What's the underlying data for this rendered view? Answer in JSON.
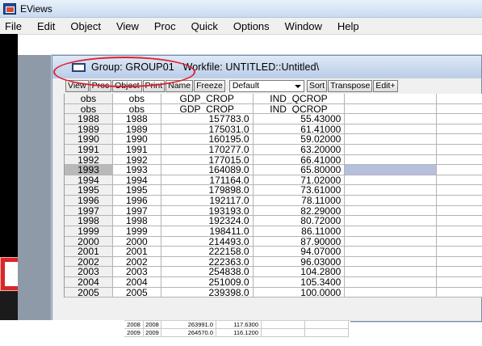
{
  "app": {
    "title": "EViews"
  },
  "menu": [
    "File",
    "Edit",
    "Object",
    "View",
    "Proc",
    "Quick",
    "Options",
    "Window",
    "Help"
  ],
  "group_window": {
    "title": "Group: GROUP01",
    "workfile": "Workfile: UNTITLED::Untitled\\",
    "toolbar": [
      "View",
      "Proc",
      "Object",
      "Print",
      "Name",
      "Freeze"
    ],
    "display_select": "Default",
    "toolbar_right": [
      "Sort",
      "Transpose",
      "Edit+"
    ]
  },
  "table": {
    "header_rows": [
      [
        "obs",
        "obs",
        "GDP_CROP",
        "IND_QCROP"
      ],
      [
        "obs",
        "obs",
        "GDP_CROP",
        "IND_QCROP"
      ]
    ],
    "rows": [
      [
        "1988",
        "1988",
        "157783.0",
        "55.43000"
      ],
      [
        "1989",
        "1989",
        "175031.0",
        "61.41000"
      ],
      [
        "1990",
        "1990",
        "160195.0",
        "59.02000"
      ],
      [
        "1991",
        "1991",
        "170277.0",
        "63.20000"
      ],
      [
        "1992",
        "1992",
        "177015.0",
        "66.41000"
      ],
      [
        "1993",
        "1993",
        "164089.0",
        "65.80000"
      ],
      [
        "1994",
        "1994",
        "171164.0",
        "71.02000"
      ],
      [
        "1995",
        "1995",
        "179898.0",
        "73.61000"
      ],
      [
        "1996",
        "1996",
        "192117.0",
        "78.11000"
      ],
      [
        "1997",
        "1997",
        "193193.0",
        "82.29000"
      ],
      [
        "1998",
        "1998",
        "192324.0",
        "80.72000"
      ],
      [
        "1999",
        "1999",
        "198411.0",
        "86.11000"
      ],
      [
        "2000",
        "2000",
        "214493.0",
        "87.90000"
      ],
      [
        "2001",
        "2001",
        "222158.0",
        "94.07000"
      ],
      [
        "2002",
        "2002",
        "222363.0",
        "96.03000"
      ],
      [
        "2003",
        "2003",
        "254838.0",
        "104.2800"
      ],
      [
        "2004",
        "2004",
        "251009.0",
        "105.3400"
      ],
      [
        "2005",
        "2005",
        "239398.0",
        "100.0000"
      ]
    ],
    "selected_row": "1993"
  },
  "snippet": {
    "rows": [
      [
        "2008",
        "2008",
        "263991.0",
        "117.6300"
      ],
      [
        "2009",
        "2009",
        "264570.0",
        "116.1200"
      ]
    ]
  },
  "colors": {
    "highlight": "#e0202e",
    "selection": "#b6bfdc",
    "titlebar": "#c9dbf0"
  }
}
